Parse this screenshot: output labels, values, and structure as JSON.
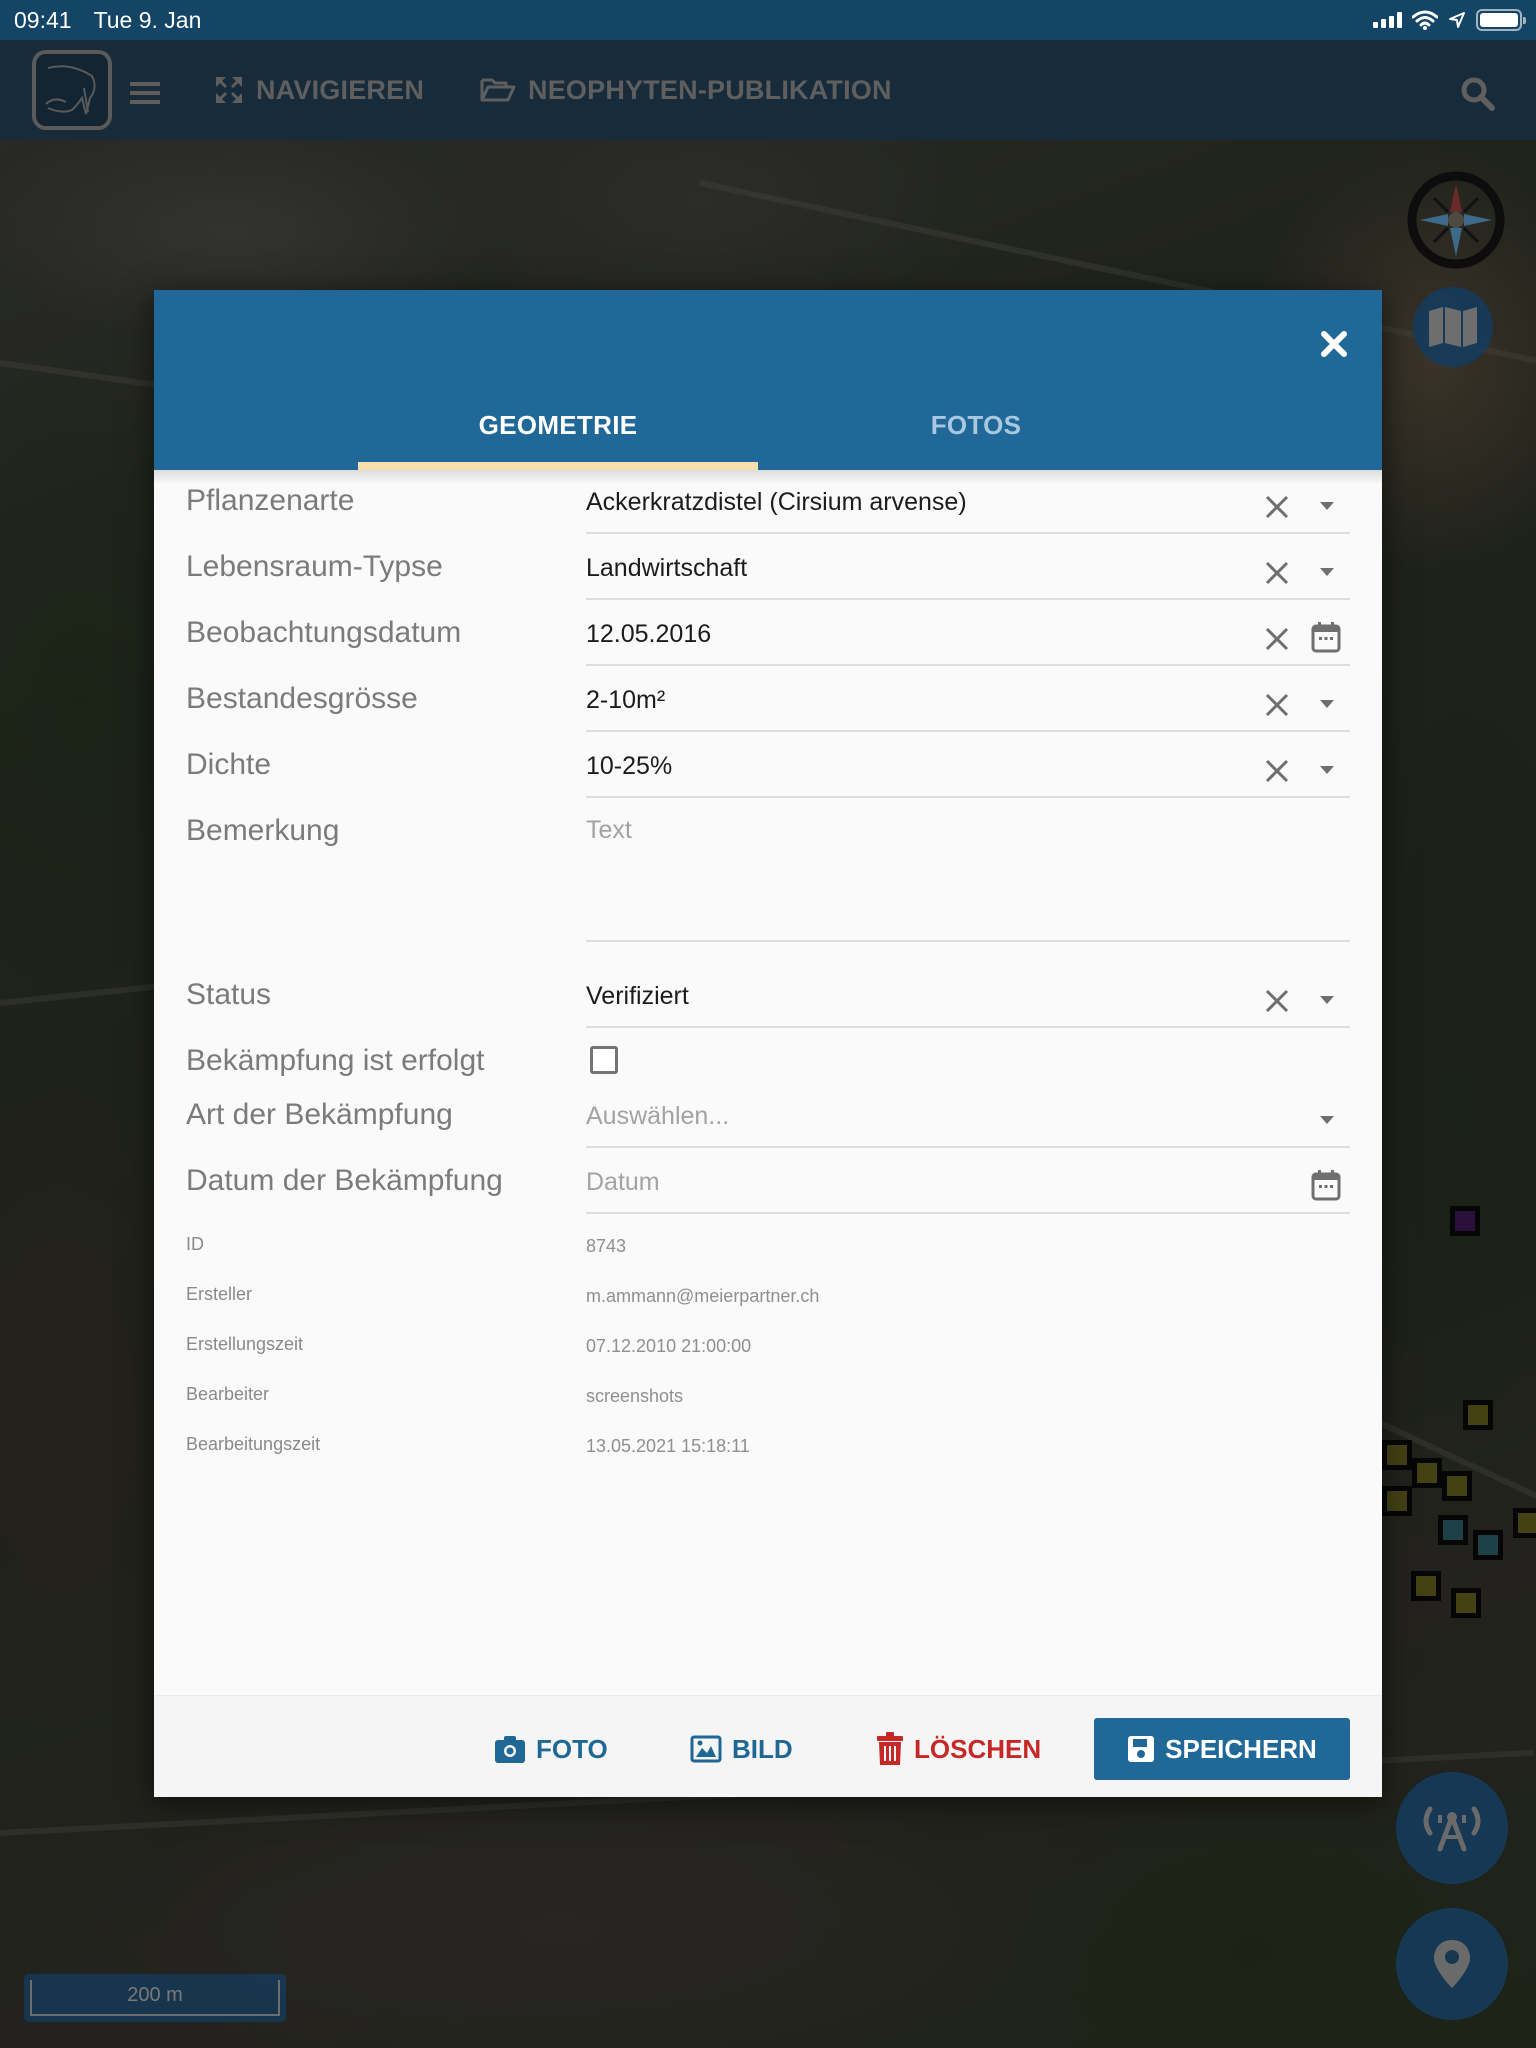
{
  "status_bar": {
    "time": "09:41",
    "date": "Tue 9. Jan"
  },
  "navbar": {
    "navigate_label": "NAVIGIEREN",
    "project_label": "NEOPHYTEN-PUBLIKATION"
  },
  "map": {
    "scale_label": "200 m",
    "marker_colors": {
      "yellow": "#6e6a1e",
      "teal": "#2e6a72",
      "purple": "#3e1450"
    }
  },
  "modal": {
    "tabs": [
      {
        "label": "GEOMETRIE",
        "active": true
      },
      {
        "label": "FOTOS",
        "active": false
      }
    ],
    "fields": [
      {
        "label": "Pflanzenarte",
        "value": "Ackerkratzdistel (Cirsium arvense)",
        "type": "select"
      },
      {
        "label": "Lebensraum-Typse",
        "value": "Landwirtschaft",
        "type": "select"
      },
      {
        "label": "Beobachtungsdatum",
        "value": "12.05.2016",
        "type": "date"
      },
      {
        "label": "Bestandesgrösse",
        "value": "2-10m²",
        "type": "select"
      },
      {
        "label": "Dichte",
        "value": "10-25%",
        "type": "select"
      },
      {
        "label": "Bemerkung",
        "value": "",
        "placeholder": "Text",
        "type": "textarea"
      },
      {
        "label": "Status",
        "value": "Verifiziert",
        "type": "select"
      },
      {
        "label": "Bekämpfung ist erfolgt",
        "checked": false,
        "type": "checkbox"
      },
      {
        "label": "Art der Bekämpfung",
        "value": "",
        "placeholder": "Auswählen...",
        "type": "select"
      },
      {
        "label": "Datum der Bekämpfung",
        "value": "",
        "placeholder": "Datum",
        "type": "date"
      }
    ],
    "meta": [
      {
        "label": "ID",
        "value": "8743"
      },
      {
        "label": "Ersteller",
        "value": "m.ammann@meierpartner.ch"
      },
      {
        "label": "Erstellungszeit",
        "value": "07.12.2010 21:00:00"
      },
      {
        "label": "Bearbeiter",
        "value": "screenshots"
      },
      {
        "label": "Bearbeitungszeit",
        "value": "13.05.2021 15:18:11"
      }
    ],
    "footer": {
      "foto_label": "FOTO",
      "bild_label": "BILD",
      "delete_label": "LÖSCHEN",
      "save_label": "SPEICHERN"
    }
  },
  "colors": {
    "primary": "#206897",
    "tab_indicator": "#f9dfae",
    "danger": "#c62828",
    "statusbar": "#144466",
    "navbar": "#182b3a"
  }
}
